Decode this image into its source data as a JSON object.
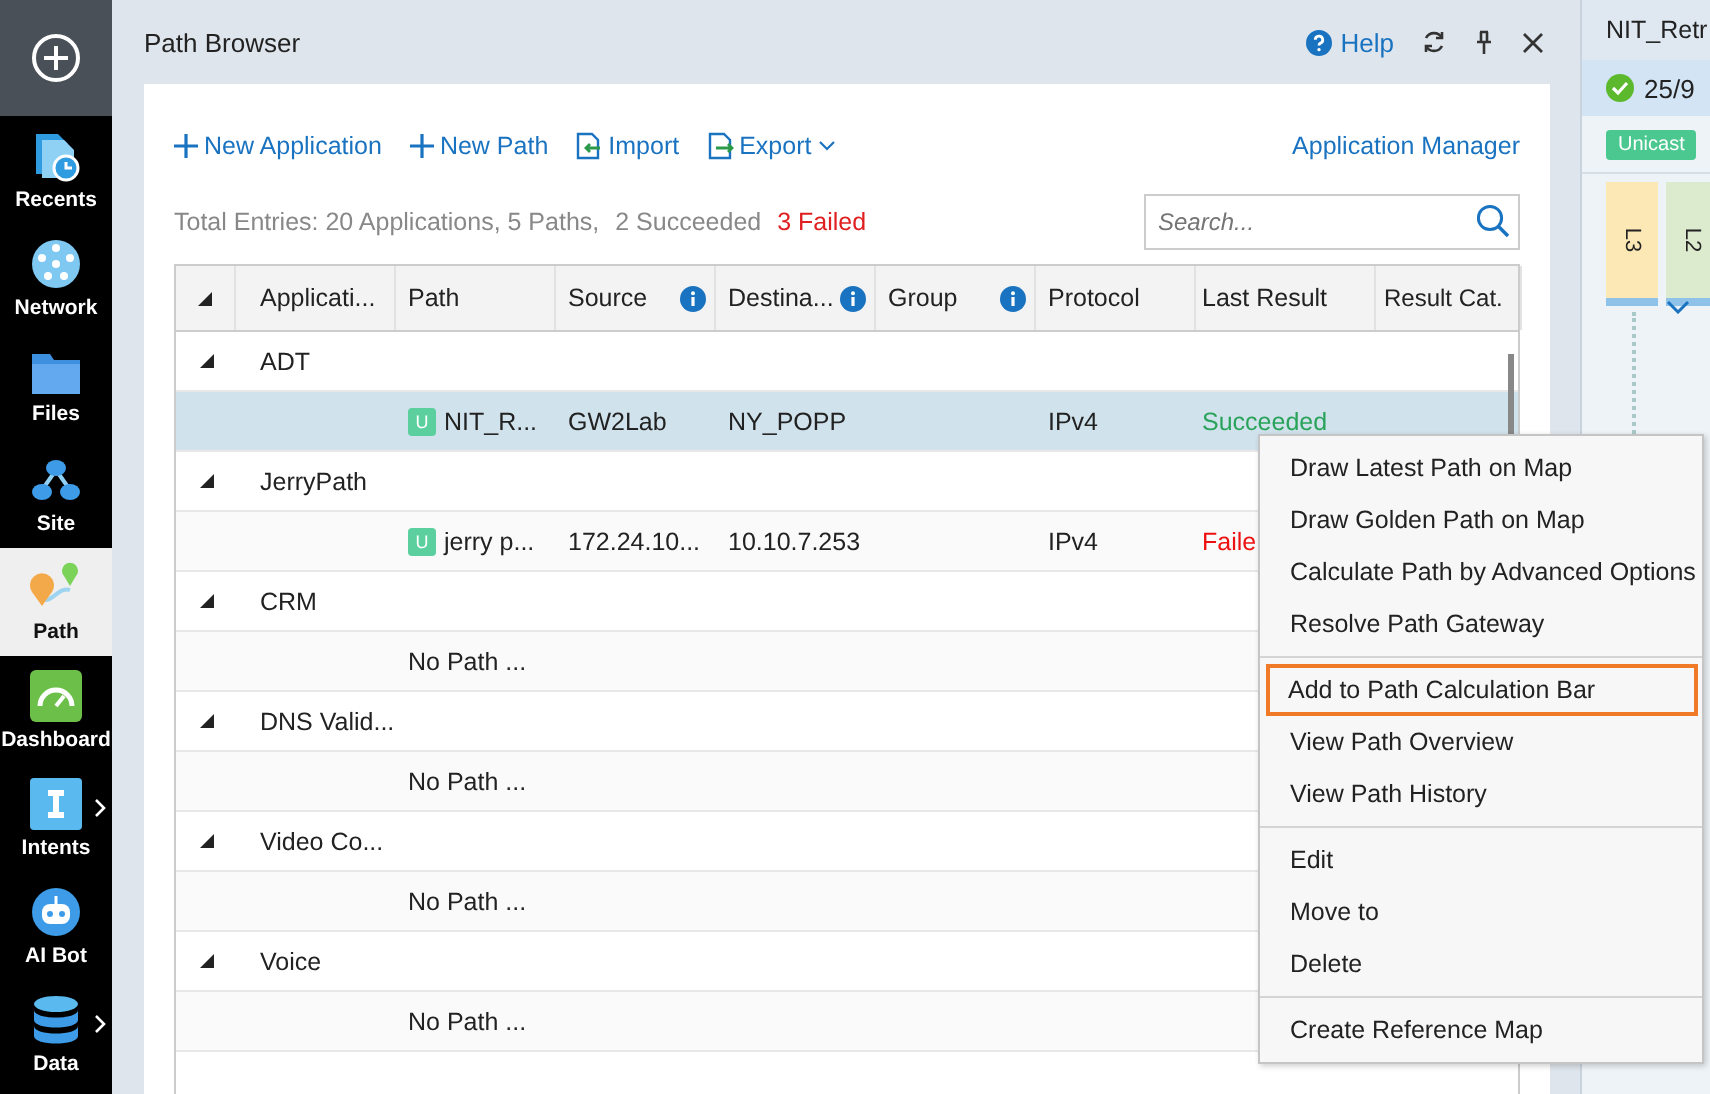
{
  "sidebar": {
    "items": [
      {
        "label": "Recents",
        "selected": false,
        "has_submenu": false
      },
      {
        "label": "Network",
        "selected": false,
        "has_submenu": false
      },
      {
        "label": "Files",
        "selected": false,
        "has_submenu": false
      },
      {
        "label": "Site",
        "selected": false,
        "has_submenu": false
      },
      {
        "label": "Path",
        "selected": true,
        "has_submenu": false
      },
      {
        "label": "Dashboard",
        "selected": false,
        "has_submenu": false
      },
      {
        "label": "Intents",
        "selected": false,
        "has_submenu": true
      },
      {
        "label": "AI Bot",
        "selected": false,
        "has_submenu": false
      },
      {
        "label": "Data",
        "selected": false,
        "has_submenu": true
      }
    ]
  },
  "panel": {
    "title": "Path Browser",
    "help": "Help",
    "actions": [
      {
        "label": "New Application",
        "dropdown": false
      },
      {
        "label": "New Path",
        "dropdown": false
      },
      {
        "label": "Import",
        "dropdown": false
      },
      {
        "label": "Export",
        "dropdown": true
      }
    ],
    "manager_link": "Application Manager",
    "summary": {
      "total": "Total Entries: 20 Applications, 5 Paths,",
      "succeeded": "2 Succeeded",
      "failed": "3 Failed"
    },
    "search": {
      "placeholder": "Search..."
    },
    "table": {
      "columns": [
        {
          "label": "Applicati...",
          "info": false
        },
        {
          "label": "Path",
          "info": false
        },
        {
          "label": "Source",
          "info": true
        },
        {
          "label": "Destina...",
          "info": true
        },
        {
          "label": "Group",
          "info": true
        },
        {
          "label": "Protocol",
          "info": false
        },
        {
          "label": "Last Result",
          "info": false
        },
        {
          "label": "Result Cat.",
          "info": false
        }
      ],
      "applications": [
        {
          "name": "ADT",
          "expanded": true,
          "children": [
            {
              "kind": "path",
              "badge": "U",
              "name": "NIT_R...",
              "source": "GW2Lab",
              "destination": "NY_POPP",
              "protocol": "IPv4",
              "last_result": "Succeeded",
              "failed": false,
              "selected": true
            }
          ]
        },
        {
          "name": "JerryPath",
          "expanded": true,
          "children": [
            {
              "kind": "path",
              "badge": "U",
              "name": "jerry p...",
              "source": "172.24.10...",
              "destination": "10.10.7.253",
              "protocol": "IPv4",
              "last_result": "Faile",
              "failed": true,
              "selected": false
            }
          ]
        },
        {
          "name": "CRM",
          "expanded": true,
          "children": [
            {
              "kind": "empty",
              "text": "No Path ..."
            }
          ]
        },
        {
          "name": "DNS Valid...",
          "expanded": true,
          "children": [
            {
              "kind": "empty",
              "text": "No Path ..."
            }
          ]
        },
        {
          "name": "Video Co...",
          "expanded": true,
          "children": [
            {
              "kind": "empty",
              "text": "No Path ..."
            }
          ]
        },
        {
          "name": "Voice",
          "expanded": true,
          "children": [
            {
              "kind": "empty",
              "text": "No Path ..."
            }
          ]
        }
      ]
    }
  },
  "context_menu": {
    "sections": [
      [
        {
          "label": "Draw Latest Path on Map",
          "selected": false
        },
        {
          "label": "Draw Golden Path on Map",
          "selected": false
        },
        {
          "label": "Calculate Path by Advanced Options",
          "selected": false
        },
        {
          "label": "Resolve Path Gateway",
          "selected": false
        }
      ],
      [
        {
          "label": "Add to Path Calculation Bar",
          "selected": true
        },
        {
          "label": "View Path Overview",
          "selected": false
        },
        {
          "label": "View Path History",
          "selected": false
        }
      ],
      [
        {
          "label": "Edit",
          "selected": false
        },
        {
          "label": "Move to",
          "selected": false
        },
        {
          "label": "Delete",
          "selected": false
        }
      ],
      [
        {
          "label": "Create Reference Map",
          "selected": false
        }
      ]
    ]
  },
  "side_panel": {
    "title": "NIT_Retr",
    "count": "25/9",
    "badge": "Unicast",
    "layers": [
      {
        "label": "L3",
        "color": "#fbe8b4"
      },
      {
        "label": "L2",
        "color": "#dcebcd"
      }
    ]
  }
}
